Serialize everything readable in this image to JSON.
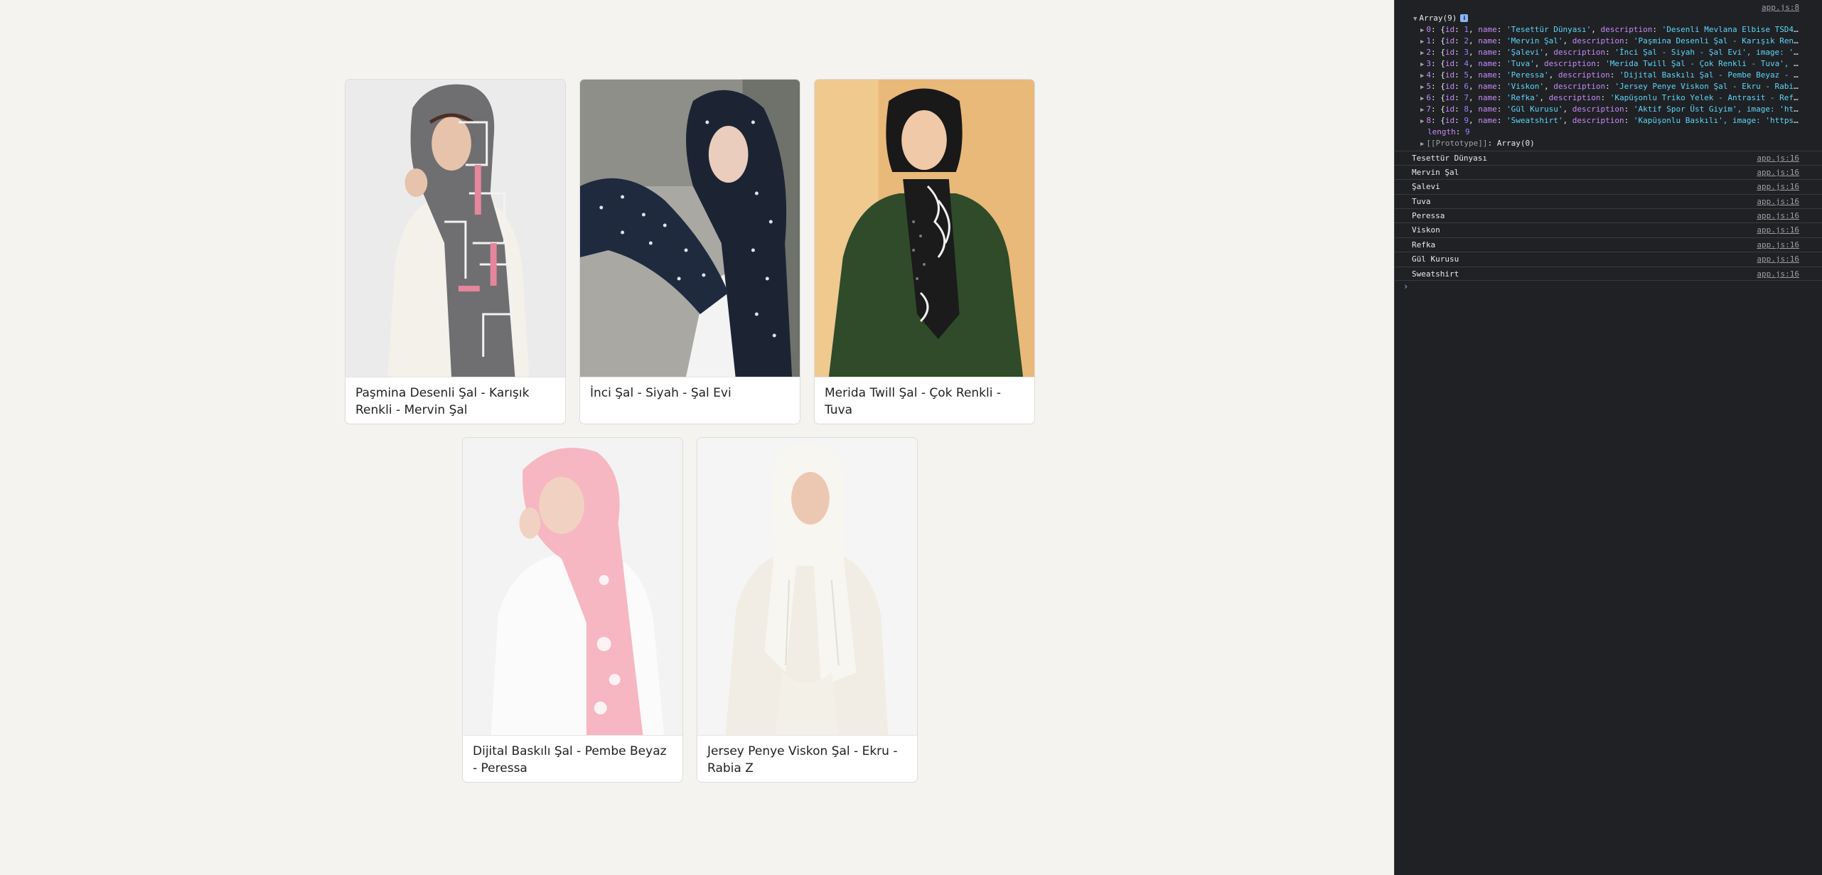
{
  "products": [
    {
      "title": "Paşmina Desenli Şal - Karışık Renkli - Mervin Şal"
    },
    {
      "title": "İnci Şal - Siyah - Şal Evi"
    },
    {
      "title": "Merida Twill Şal - Çok Renkli - Tuva"
    },
    {
      "title": "Dijital Baskılı Şal - Pembe Beyaz - Peressa"
    },
    {
      "title": "Jersey Penye Viskon Şal - Ekru - Rabia Z"
    }
  ],
  "console": {
    "top_source": "app.js:8",
    "array_label": "Array(9)",
    "array_badge": "i",
    "array_items": [
      {
        "idx": "0",
        "id": "1",
        "name": "'Tesettür Dünyası'",
        "desc_key": "description",
        "desc": "'Desenli Mevlana Elbise TSD44…"
      },
      {
        "idx": "1",
        "id": "2",
        "name": "'Mervin Şal'",
        "desc_key": "description",
        "desc": "'Paşmina Desenli Şal - Karışık Renk…"
      },
      {
        "idx": "2",
        "id": "3",
        "name": "'Şalevi'",
        "desc_key": "description",
        "desc": "'İnci Şal - Siyah - Şal Evi', image: 'h…"
      },
      {
        "idx": "3",
        "id": "4",
        "name": "'Tuva'",
        "desc_key": "description",
        "desc": "'Merida Twill Şal - Çok Renkli - Tuva', i…"
      },
      {
        "idx": "4",
        "id": "5",
        "name": "'Peressa'",
        "desc_key": "description",
        "desc": "'Dijital Baskılı Şal - Pembe Beyaz - P…"
      },
      {
        "idx": "5",
        "id": "6",
        "name": "'Viskon'",
        "desc_key": "description",
        "desc": "'Jersey Penye Viskon Şal - Ekru - Rabia…"
      },
      {
        "idx": "6",
        "id": "7",
        "name": "'Refka'",
        "desc_key": "description",
        "desc": "'Kapüşonlu Triko Yelek - Antrasit - Refk…"
      },
      {
        "idx": "7",
        "id": "8",
        "name": "'Gül Kurusu'",
        "desc_key": "description",
        "desc": "'Aktif Spor Üst Giyim', image: 'htt…"
      },
      {
        "idx": "8",
        "id": "9",
        "name": "'Sweatshirt'",
        "desc_key": "description",
        "desc": "'Kapüşonlu Baskılı', image: 'https:…"
      }
    ],
    "length_key": "length",
    "length_value": "9",
    "prototype_key": "[[Prototype]]",
    "prototype_value": "Array(0)",
    "messages": [
      {
        "text": "Tesettür Dünyası",
        "source": "app.js:16"
      },
      {
        "text": "Mervin Şal",
        "source": "app.js:16"
      },
      {
        "text": "Şalevi",
        "source": "app.js:16"
      },
      {
        "text": "Tuva",
        "source": "app.js:16"
      },
      {
        "text": "Peressa",
        "source": "app.js:16"
      },
      {
        "text": "Viskon",
        "source": "app.js:16"
      },
      {
        "text": "Refka",
        "source": "app.js:16"
      },
      {
        "text": "Gül Kurusu",
        "source": "app.js:16"
      },
      {
        "text": "Sweatshirt",
        "source": "app.js:16"
      }
    ],
    "prompt_icon": "chevron-right-icon"
  },
  "colors": {
    "page_bg": "#f4f3f0",
    "console_bg": "#202124",
    "console_string": "#5cd5fb",
    "console_key": "#c58af9",
    "console_number": "#9980ff"
  }
}
